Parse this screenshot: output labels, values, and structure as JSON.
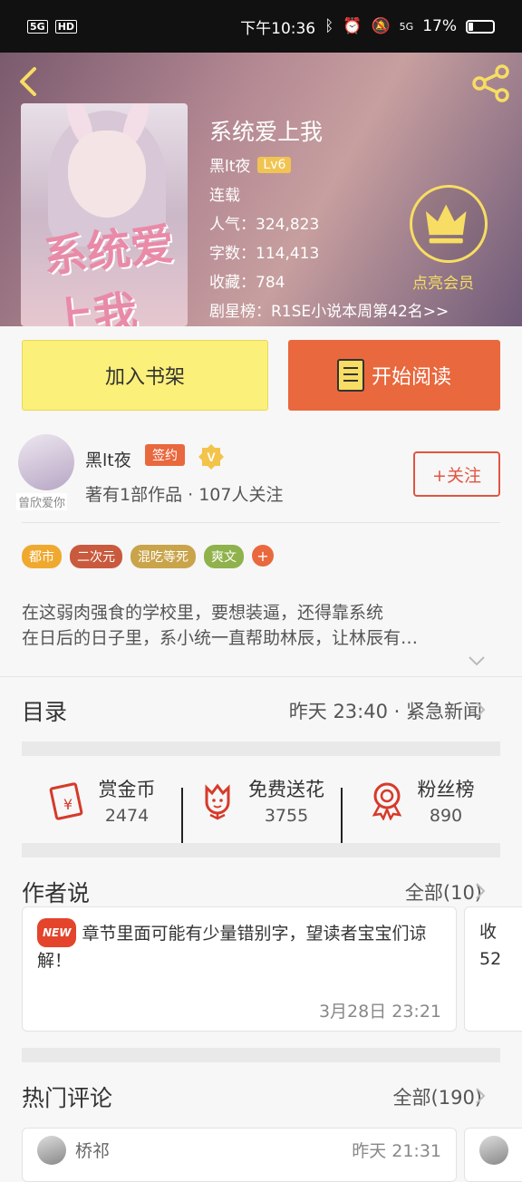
{
  "status": {
    "network": "5G",
    "hd": "HD",
    "time": "下午10:36",
    "icons": [
      "bluetooth-icon",
      "alarm-icon",
      "mute-icon",
      "5g-signal-icon"
    ],
    "battery": "17%",
    "battery_level": 0.17
  },
  "book": {
    "title": "系统爱上我",
    "cover_text": "系统爱上我",
    "author": "黑lt夜",
    "level": "Lv6",
    "status": "连载",
    "popularity": "人气：324,823",
    "word_count": "字数：114,413",
    "favorites": "收藏：784",
    "rank": "剧星榜：R1SE小说本周第42名>>",
    "vip_label": "点亮会员"
  },
  "actions": {
    "add_shelf": "加入书架",
    "start_read": "开始阅读"
  },
  "author": {
    "avatar_caption": "曾欣爱你",
    "name": "黑lt夜",
    "signed": "签约",
    "sub": "著有1部作品 · 107人关注",
    "follow": "+关注"
  },
  "tags": [
    {
      "label": "都市",
      "color": "#f0a92f"
    },
    {
      "label": "二次元",
      "color": "#c95a3e"
    },
    {
      "label": "混吃等死",
      "color": "#c9a44b"
    },
    {
      "label": "爽文",
      "color": "#8fb24c"
    }
  ],
  "tag_more": "+",
  "description": {
    "line1": "在这弱肉强食的学校里，要想装逼，还得靠系统",
    "line2": "在日后的日子里，系小统一直帮助林辰，让林辰有…"
  },
  "toc": {
    "title": "目录",
    "latest": "昨天 23:40 · 紧急新闻"
  },
  "stats": [
    {
      "label": "赏金币",
      "value": "2474"
    },
    {
      "label": "免费送花",
      "value": "3755"
    },
    {
      "label": "粉丝榜",
      "value": "890"
    }
  ],
  "author_says": {
    "title": "作者说",
    "all": "全部(10)",
    "badge": "NEW",
    "text": "章节里面可能有少量错别字，望读者宝宝们谅解！",
    "time": "3月28日 23:21",
    "peek1": "收",
    "peek2": "52"
  },
  "hot_comments": {
    "title": "热门评论",
    "all": "全部(190)",
    "user": "桥祁",
    "time": "昨天 21:31"
  },
  "colors": {
    "accent": "#e9683d",
    "gold": "#f7dd63"
  }
}
